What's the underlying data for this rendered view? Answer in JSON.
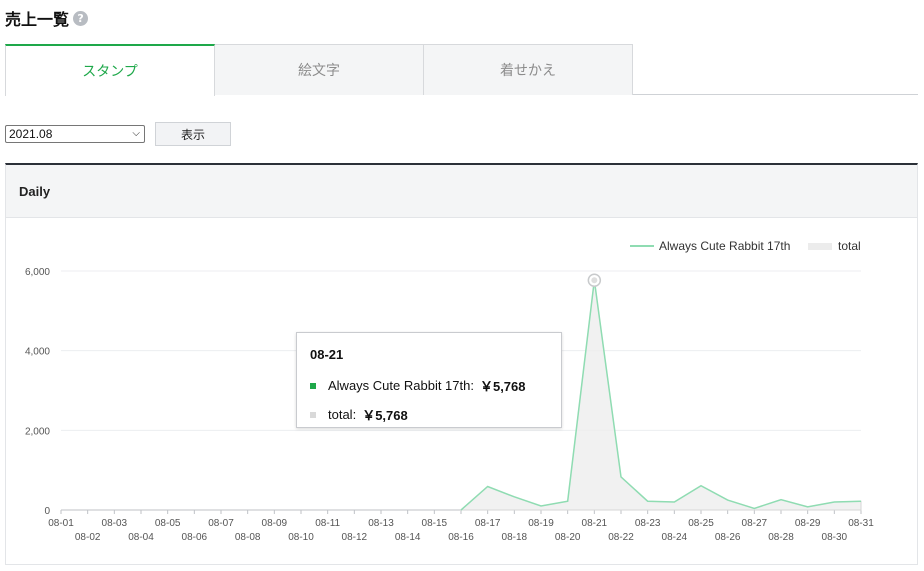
{
  "page": {
    "title": "売上一覧",
    "help_icon": "question-circle-icon"
  },
  "tabs": [
    {
      "label": "スタンプ",
      "active": true
    },
    {
      "label": "絵文字",
      "active": false
    },
    {
      "label": "着せかえ",
      "active": false
    }
  ],
  "filter": {
    "selected_month": "2021.08",
    "show_button": "表示"
  },
  "panel": {
    "title": "Daily"
  },
  "colors": {
    "accent_green": "#1ea84a",
    "series_line": "#8fdcb2",
    "total_fill": "#eeeeee"
  },
  "chart_data": {
    "type": "area",
    "x": [
      "08-01",
      "08-02",
      "08-03",
      "08-04",
      "08-05",
      "08-06",
      "08-07",
      "08-08",
      "08-09",
      "08-10",
      "08-11",
      "08-12",
      "08-13",
      "08-14",
      "08-15",
      "08-16",
      "08-17",
      "08-18",
      "08-19",
      "08-20",
      "08-21",
      "08-22",
      "08-23",
      "08-24",
      "08-25",
      "08-26",
      "08-27",
      "08-28",
      "08-29",
      "08-30",
      "08-31"
    ],
    "series": [
      {
        "name": "Always Cute Rabbit 17th",
        "values": [
          0,
          0,
          0,
          0,
          0,
          0,
          0,
          0,
          0,
          0,
          0,
          0,
          0,
          0,
          0,
          0,
          590,
          330,
          100,
          220,
          5768,
          830,
          220,
          200,
          610,
          250,
          40,
          260,
          80,
          200,
          220
        ]
      },
      {
        "name": "total",
        "values": [
          0,
          0,
          0,
          0,
          0,
          0,
          0,
          0,
          0,
          0,
          0,
          0,
          0,
          0,
          0,
          0,
          590,
          330,
          100,
          220,
          5768,
          830,
          220,
          200,
          610,
          250,
          40,
          260,
          80,
          200,
          220
        ]
      }
    ],
    "ylim": [
      0,
      6000
    ],
    "yticks": [
      "0",
      "2,000",
      "4,000",
      "6,000"
    ],
    "grid": true,
    "legend": "top-right",
    "highlight": {
      "date": "08-21",
      "series_label": "Always Cute Rabbit 17th:",
      "series_value": "￥5,768",
      "total_label": "total:",
      "total_value": "￥5,768"
    }
  }
}
